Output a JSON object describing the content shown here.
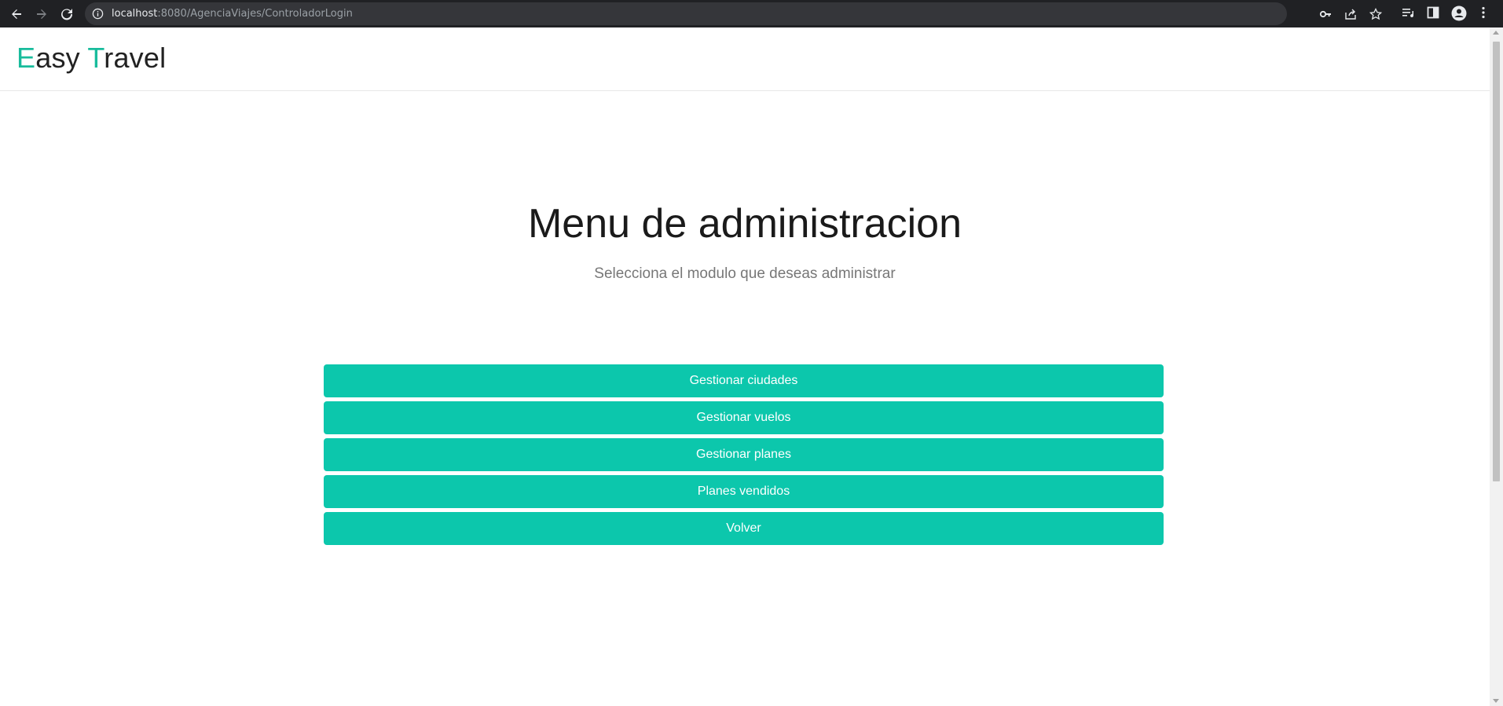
{
  "browser": {
    "url_host": "localhost",
    "url_rest": ":8080/AgenciaViajes/ControladorLogin"
  },
  "brand": {
    "first_initial": "E",
    "first_rest": "asy ",
    "second_initial": "T",
    "second_rest": "ravel",
    "accent_color": "#18bc9c"
  },
  "main": {
    "title": "Menu de administracion",
    "subtitle": "Selecciona el modulo que deseas administrar"
  },
  "menu": {
    "button_color": "#0cc7ac",
    "items": [
      {
        "label": "Gestionar ciudades"
      },
      {
        "label": "Gestionar vuelos"
      },
      {
        "label": "Gestionar planes"
      },
      {
        "label": "Planes vendidos"
      },
      {
        "label": "Volver"
      }
    ]
  }
}
